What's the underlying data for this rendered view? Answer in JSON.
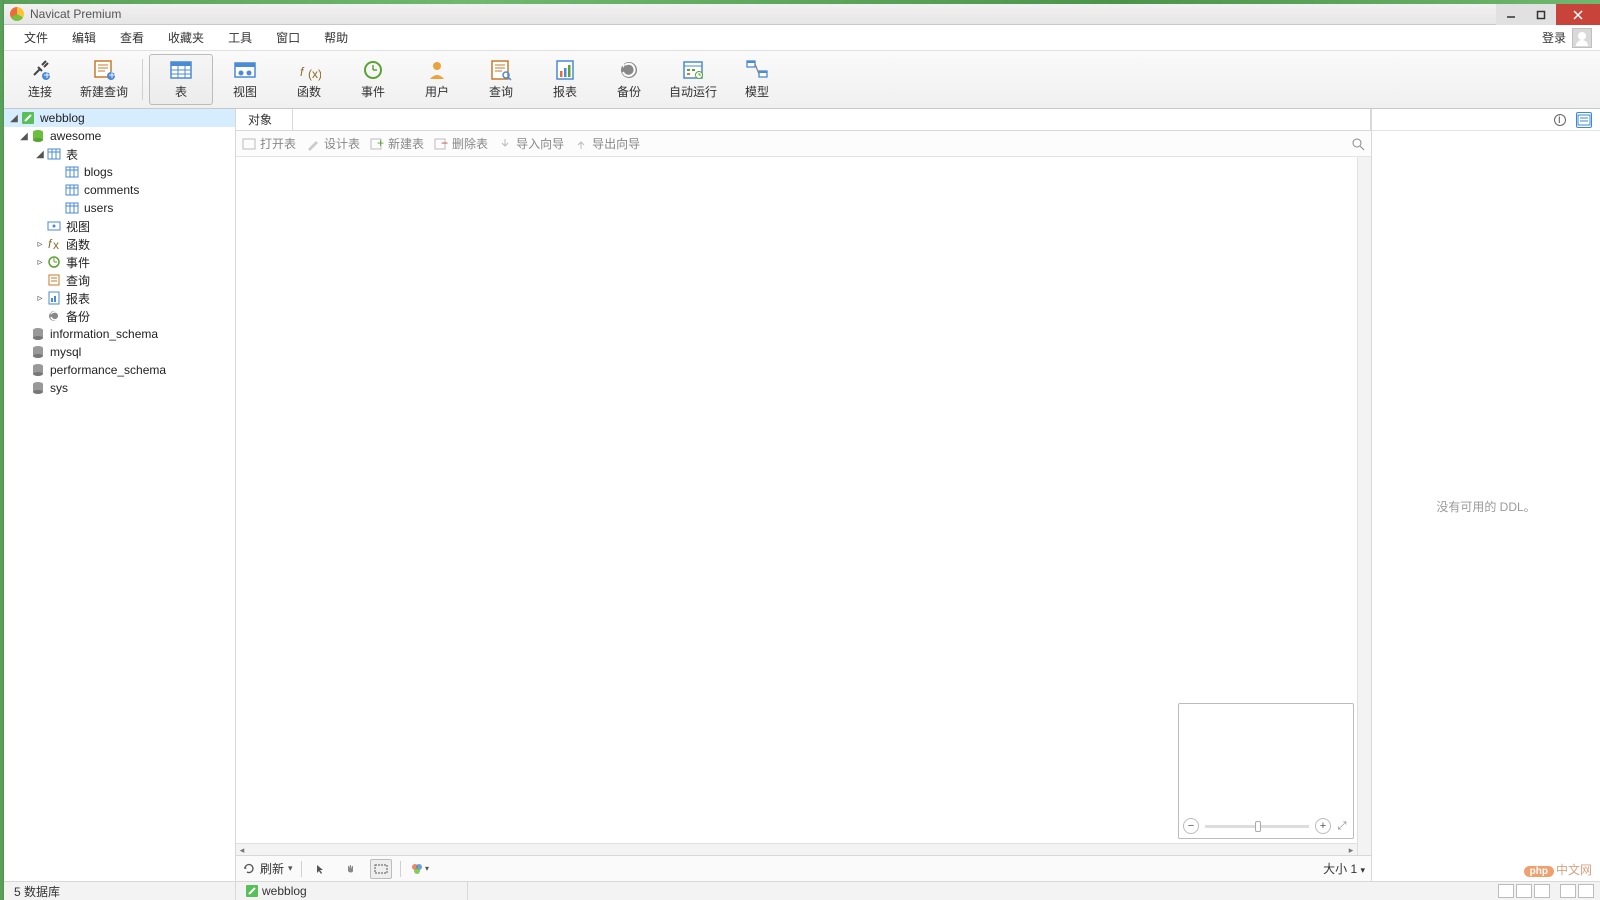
{
  "window": {
    "title": "Navicat Premium"
  },
  "menu": {
    "items": [
      "文件",
      "编辑",
      "查看",
      "收藏夹",
      "工具",
      "窗口",
      "帮助"
    ],
    "login": "登录"
  },
  "toolbar": {
    "buttons": [
      {
        "id": "connect",
        "label": "连接",
        "icon": "plug"
      },
      {
        "id": "new-query",
        "label": "新建查询",
        "icon": "query-plus"
      },
      {
        "id": "table",
        "label": "表",
        "icon": "table",
        "active": true
      },
      {
        "id": "view",
        "label": "视图",
        "icon": "view"
      },
      {
        "id": "function",
        "label": "函数",
        "icon": "fx"
      },
      {
        "id": "event",
        "label": "事件",
        "icon": "clock"
      },
      {
        "id": "user",
        "label": "用户",
        "icon": "person"
      },
      {
        "id": "query",
        "label": "查询",
        "icon": "query"
      },
      {
        "id": "report",
        "label": "报表",
        "icon": "report"
      },
      {
        "id": "backup",
        "label": "备份",
        "icon": "backup"
      },
      {
        "id": "automation",
        "label": "自动运行",
        "icon": "schedule"
      },
      {
        "id": "model",
        "label": "模型",
        "icon": "model"
      }
    ]
  },
  "tree": {
    "connection": "webblog",
    "database": "awesome",
    "tables_group": "表",
    "tables": [
      "blogs",
      "comments",
      "users"
    ],
    "views": "视图",
    "functions": "函数",
    "events": "事件",
    "queries": "查询",
    "reports": "报表",
    "backups": "备份",
    "other_dbs": [
      "information_schema",
      "mysql",
      "performance_schema",
      "sys"
    ]
  },
  "tabs": {
    "object": "对象"
  },
  "subtoolbar": {
    "open": "打开表",
    "design": "设计表",
    "new": "新建表",
    "delete": "删除表",
    "import": "导入向导",
    "export": "导出向导"
  },
  "bottombar": {
    "refresh": "刷新",
    "size": "大小 1"
  },
  "rightpane": {
    "empty": "没有可用的 DDL。"
  },
  "statusbar": {
    "count": "5 数据库",
    "path": "webblog"
  },
  "watermark": {
    "badge": "php",
    "text": "中文网"
  }
}
